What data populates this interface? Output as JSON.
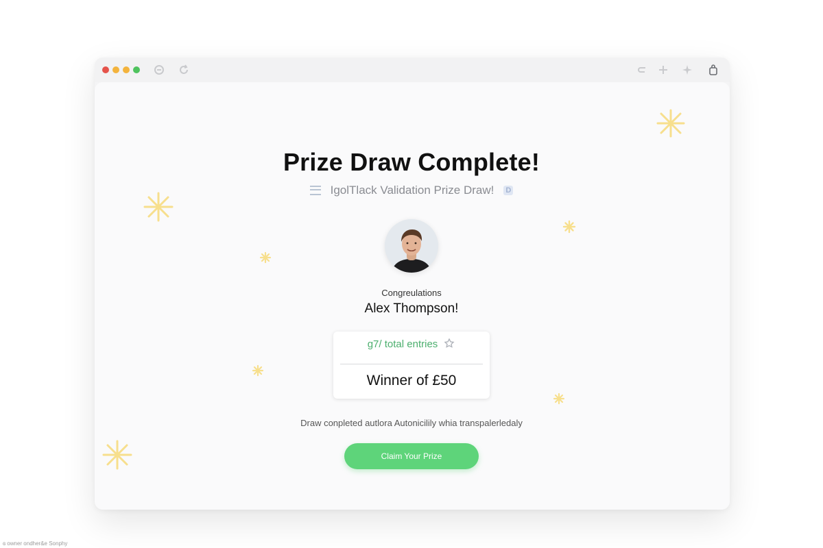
{
  "window": {
    "traffic_lights": [
      "#e5534b",
      "#f3b33d",
      "#f3b33d",
      "#4fc35e"
    ],
    "titlebar_icons_left": [
      "back-icon",
      "reload-icon"
    ],
    "titlebar_icons_right": [
      "undo-icon",
      "plus-icon",
      "sparkle-icon",
      "share-icon"
    ]
  },
  "main": {
    "title": "Prize Draw Complete!",
    "subtitle": "I‍golTlack Validation Prize Draw!",
    "congrats_label": "Congreulations",
    "winner_name": "Alex Thompson!",
    "entries_text": "g7‍/ total entries",
    "prize_text": "Winner of £50",
    "note": "Draw conpleted autlora Autonicilily whia transpalerledaly",
    "claim_button_label": "Claim Your Prize"
  },
  "colors": {
    "accent_green": "#5ed47a",
    "entries_green": "#4caf6e",
    "sparkle_yellow": "#f7df8d"
  },
  "footer": {
    "text": "ɞ owner ondher&e Sonphy"
  }
}
